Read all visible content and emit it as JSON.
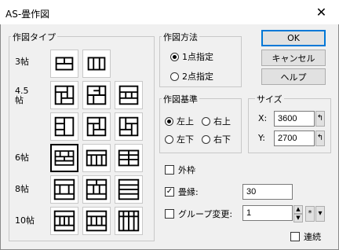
{
  "window": {
    "title": "AS-畳作図",
    "close_glyph": "✕"
  },
  "type_group": {
    "label": "作図タイプ",
    "rows": [
      {
        "label": "3帖"
      },
      {
        "label": "4.5帖"
      },
      {
        "label": "6帖"
      },
      {
        "label": "8帖"
      },
      {
        "label": "10帖"
      }
    ]
  },
  "method_group": {
    "label": "作図方法",
    "options": [
      {
        "label": "1点指定",
        "checked": true
      },
      {
        "label": "2点指定",
        "checked": false
      }
    ]
  },
  "base_group": {
    "label": "作図基準",
    "options": [
      {
        "label": "左上",
        "checked": true
      },
      {
        "label": "右上",
        "checked": false
      },
      {
        "label": "左下",
        "checked": false
      },
      {
        "label": "右下",
        "checked": false
      }
    ]
  },
  "size_group": {
    "label": "サイズ",
    "x_label": "X:",
    "x_value": "3600",
    "y_label": "Y:",
    "y_value": "2700"
  },
  "buttons": {
    "ok": "OK",
    "cancel": "キャンセル",
    "help": "ヘルプ"
  },
  "options": {
    "outer_frame": {
      "label": "外枠",
      "checked": false
    },
    "tatami_edge": {
      "label": "畳縁:",
      "checked": true,
      "value": "30"
    },
    "group_change": {
      "label": "グループ変更:",
      "checked": false,
      "value": "1",
      "star": "*"
    },
    "continuous": {
      "label": "連続",
      "checked": false
    }
  },
  "icons": {
    "x_pick": "pick-icon",
    "y_pick": "pick-icon"
  }
}
